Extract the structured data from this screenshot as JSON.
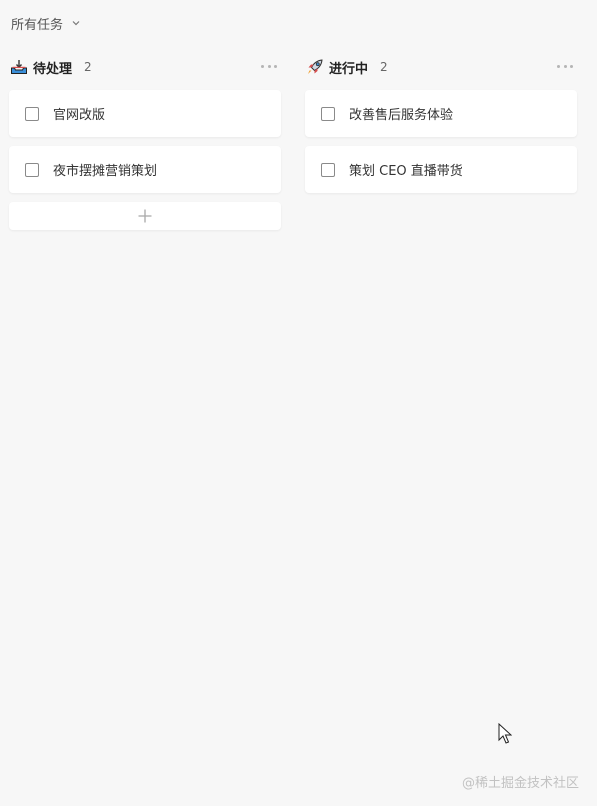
{
  "filter": {
    "label": "所有任务"
  },
  "columns": [
    {
      "title": "待处理",
      "count": "2",
      "icon": "inbox-tray-icon",
      "cards": [
        {
          "text": "官网改版"
        },
        {
          "text": "夜市摆摊营销策划"
        }
      ]
    },
    {
      "title": "进行中",
      "count": "2",
      "icon": "rocket-icon",
      "cards": [
        {
          "text": "改善售后服务体验"
        },
        {
          "text": "策划 CEO 直播带货"
        }
      ]
    }
  ],
  "watermark": "@稀土掘金技术社区",
  "colors": {
    "background": "#f7f7f7",
    "card": "#ffffff",
    "text": "#333333",
    "muted": "#b5b5b5"
  }
}
